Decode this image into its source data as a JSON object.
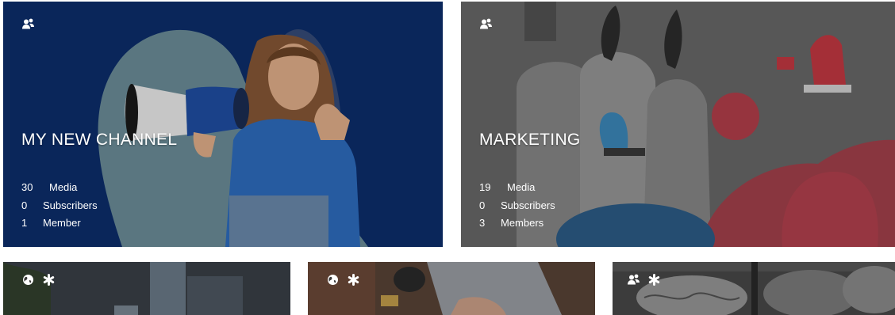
{
  "colors": {
    "card1_bg": "#0d2f6e",
    "card2_bg": "#6f6f6f",
    "text": "#ffffff"
  },
  "cards": [
    {
      "icons": [
        "group-icon"
      ],
      "title": "MY NEW CHANNEL",
      "stats": {
        "media_count": "30",
        "media_label": "Media",
        "subscribers_count": "0",
        "subscribers_label": "Subscribers",
        "members_count": "1",
        "members_label": "Member"
      }
    },
    {
      "icons": [
        "group-icon"
      ],
      "title": "MARKETING",
      "stats": {
        "media_count": "19",
        "media_label": "Media",
        "subscribers_count": "0",
        "subscribers_label": "Subscribers",
        "members_count": "3",
        "members_label": "Members"
      }
    },
    {
      "icons": [
        "globe-icon",
        "asterisk-icon"
      ]
    },
    {
      "icons": [
        "globe-icon",
        "asterisk-icon"
      ]
    },
    {
      "icons": [
        "group-icon",
        "asterisk-icon"
      ]
    }
  ]
}
